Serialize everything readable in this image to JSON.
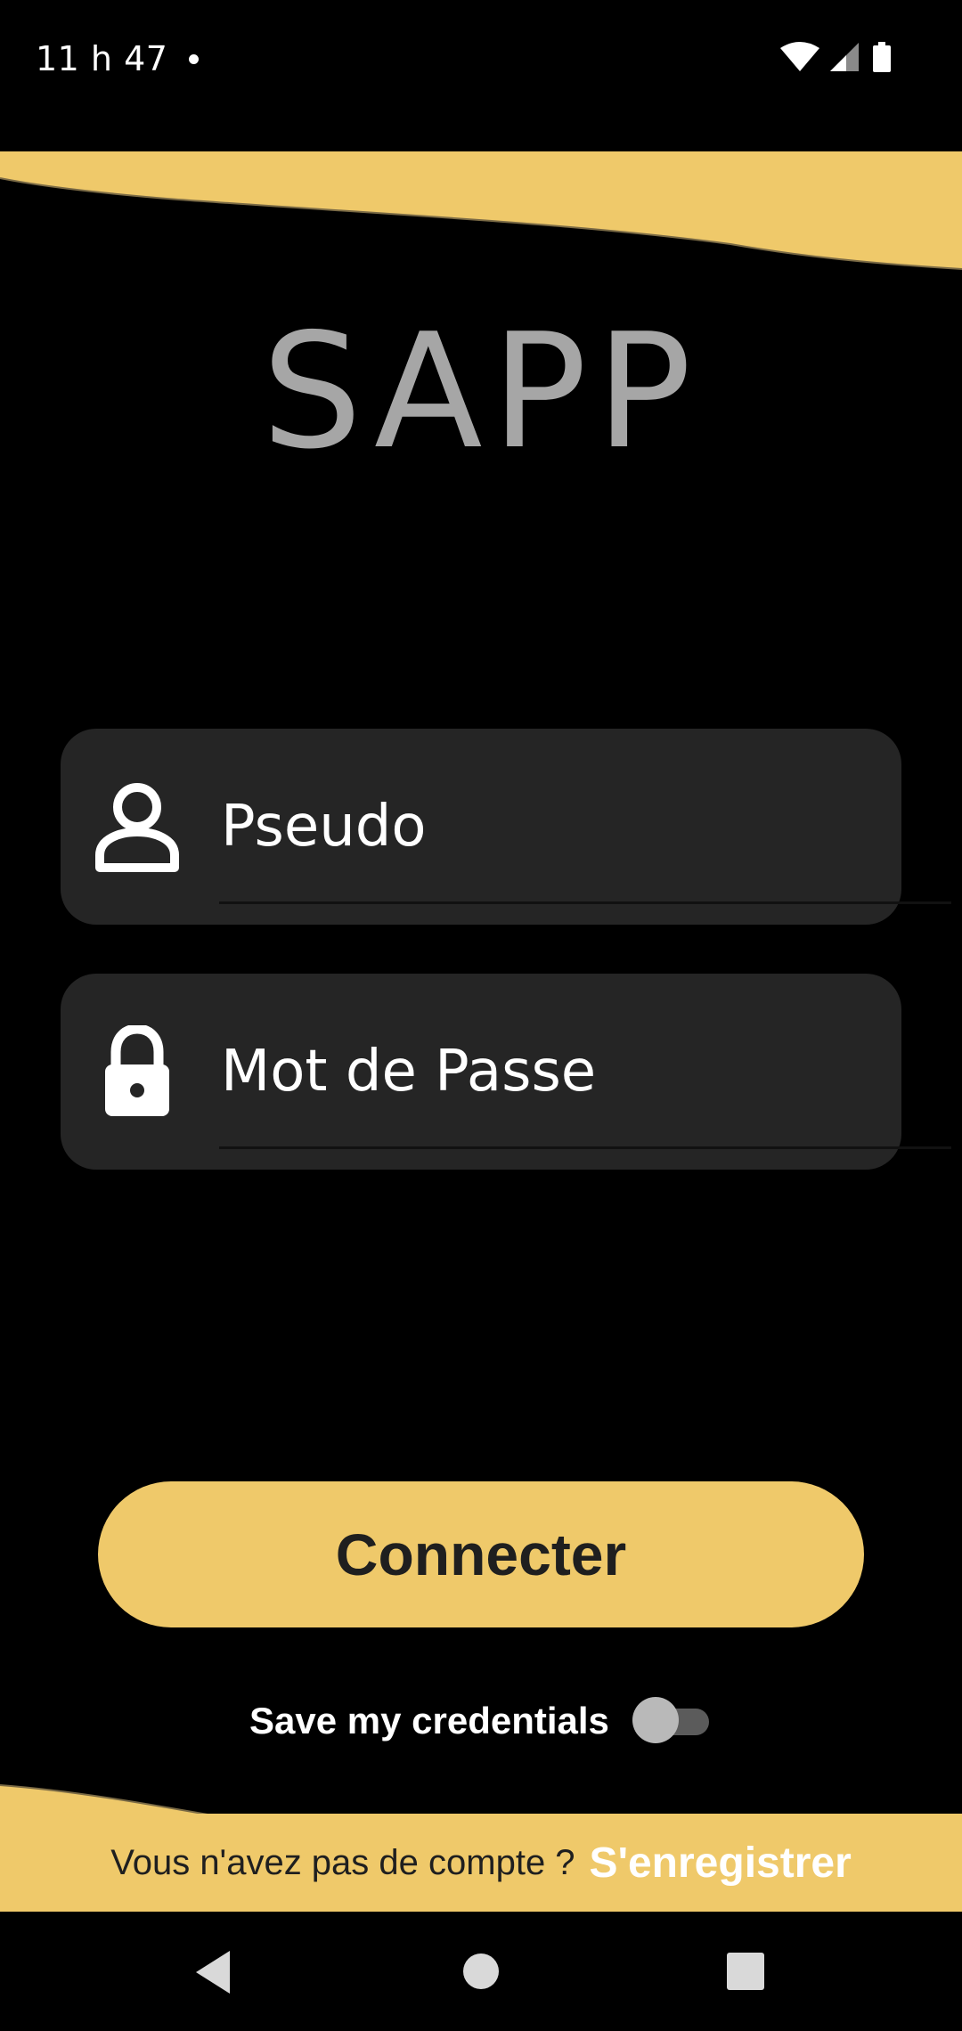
{
  "status_bar": {
    "time": "11 h 47",
    "icons": [
      "notification-dot-icon",
      "wifi-icon",
      "cellular-signal-icon",
      "battery-icon"
    ]
  },
  "app": {
    "title": "SAPP"
  },
  "login_form": {
    "username": {
      "icon": "person-icon",
      "placeholder": "Pseudo",
      "value": ""
    },
    "password": {
      "icon": "lock-icon",
      "placeholder": "Mot de Passe",
      "value": ""
    },
    "connect_label": "Connecter",
    "remember": {
      "label": "Save my credentials",
      "checked": false
    }
  },
  "footer": {
    "question": "Vous n'avez pas de compte ?",
    "register_label": "S'enregistrer"
  },
  "nav_bar": {
    "icons": [
      "back-icon",
      "home-icon",
      "recents-icon"
    ]
  },
  "colors": {
    "background": "#000000",
    "accent": "#efc96a",
    "field_background": "#252525",
    "title_gray": "#a6a6a6",
    "button_text": "#1f1f1f"
  }
}
